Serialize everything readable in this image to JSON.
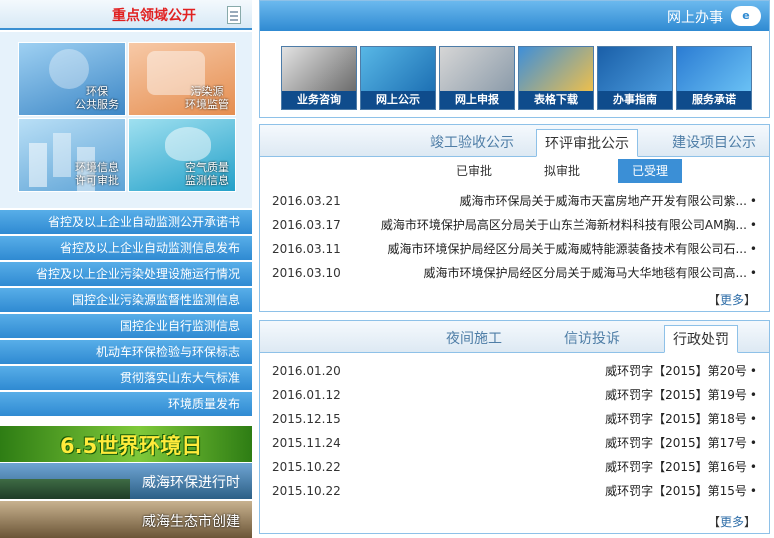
{
  "sidebar": {
    "title": "重点领域公开",
    "tiles": [
      {
        "label": "环保\n公共服务"
      },
      {
        "label": "污染源\n环境监管"
      },
      {
        "label": "环境信息\n许可审批"
      },
      {
        "label": "空气质量\n监测信息"
      }
    ],
    "links": [
      "省控及以上企业自动监测公开承诺书",
      "省控及以上企业自动监测信息发布",
      "省控及以上企业污染处理设施运行情况",
      "国控企业污染源监督性监测信息",
      "国控企业自行监测信息",
      "机动车环保检验与环保标志",
      "贯彻落实山东大气标准",
      "环境质量发布"
    ],
    "banners": [
      "6.5世界环境日",
      "威海环保进行时",
      "威海生态市创建"
    ]
  },
  "online": {
    "title": "网上办事",
    "logo": "e",
    "services": [
      "服务承诺",
      "办事指南",
      "表格下载",
      "网上申报",
      "网上公示",
      "业务咨询"
    ]
  },
  "project": {
    "tabs": [
      "建设项目公示",
      "环评审批公示",
      "竣工验收公示"
    ],
    "active_tab": 1,
    "subtabs": [
      "已受理",
      "拟审批",
      "已审批"
    ],
    "rows": [
      {
        "text": "威海市环保局关于威海市天富房地产开发有限公司紫...",
        "date": "2016.03.21"
      },
      {
        "text": "威海市环境保护局高区分局关于山东兰海新材料科技有限公司AM胸...",
        "date": "2016.03.17"
      },
      {
        "text": "威海市环境保护局经区分局关于威海威特能源装备技术有限公司石...",
        "date": "2016.03.11"
      },
      {
        "text": "威海市环境保护局经区分局关于威海马大华地毯有限公司高...",
        "date": "2016.03.10"
      }
    ],
    "more": "更多"
  },
  "penalty": {
    "tabs": [
      "行政处罚",
      "信访投诉",
      "夜间施工"
    ],
    "rows": [
      {
        "text": "威环罚字【2015】第20号",
        "date": "2016.01.20"
      },
      {
        "text": "威环罚字【2015】第19号",
        "date": "2016.01.12"
      },
      {
        "text": "威环罚字【2015】第18号",
        "date": "2015.12.15"
      },
      {
        "text": "威环罚字【2015】第17号",
        "date": "2015.11.24"
      },
      {
        "text": "威环罚字【2015】第16号",
        "date": "2015.10.22"
      },
      {
        "text": "威环罚字【2015】第15号",
        "date": "2015.10.22"
      }
    ],
    "more": "更多"
  }
}
